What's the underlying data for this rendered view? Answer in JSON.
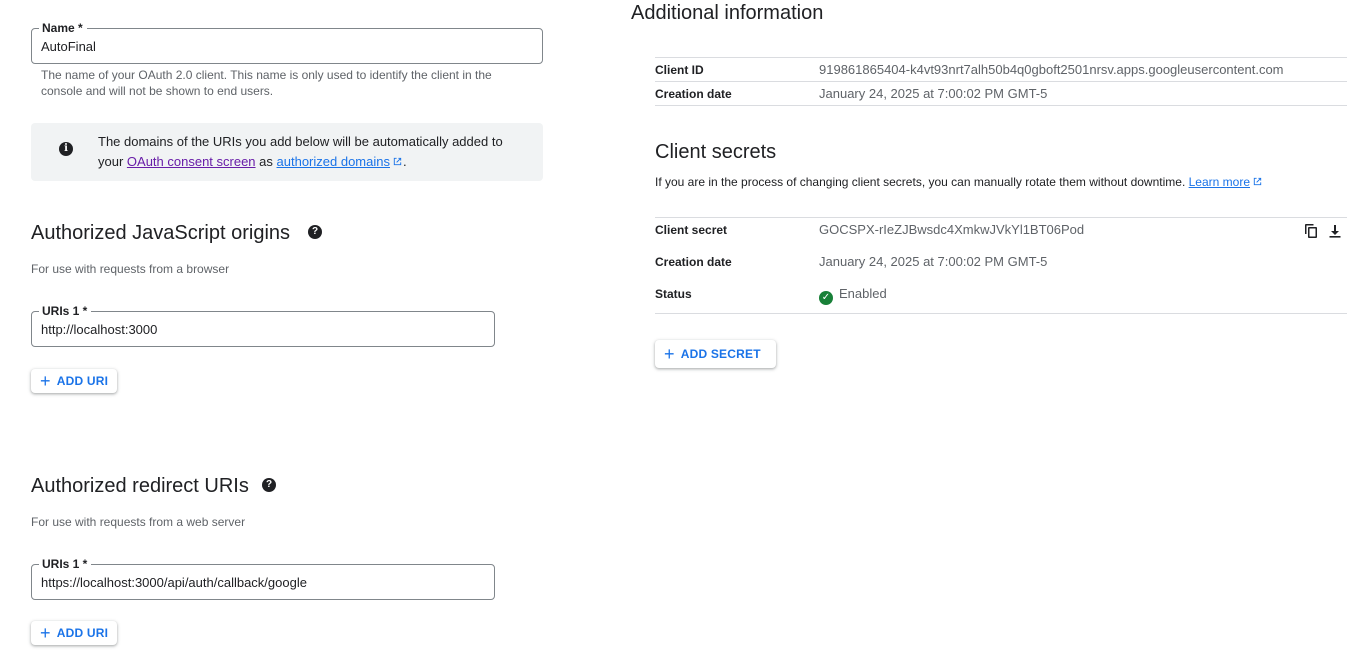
{
  "name_field": {
    "label": "Name *",
    "value": "AutoFinal",
    "help": "The name of your OAuth 2.0 client. This name is only used to identify the client in the console and will not be shown to end users."
  },
  "info_banner": {
    "icon": "info-icon",
    "text_before": "The domains of the URIs you add below will be automatically added to your ",
    "link1": "OAuth consent screen",
    "text_middle": " as ",
    "link2": "authorized domains",
    "text_after": "."
  },
  "js_origins": {
    "title": "Authorized JavaScript origins",
    "description": "For use with requests from a browser",
    "uri_label": "URIs 1 *",
    "uri_value": "http://localhost:3000",
    "add_label": "ADD URI"
  },
  "redirect_uris": {
    "title": "Authorized redirect URIs",
    "description": "For use with requests from a web server",
    "uri_label": "URIs 1 *",
    "uri_value": "https://localhost:3000/api/auth/callback/google",
    "add_label": "ADD URI"
  },
  "additional_info": {
    "title": "Additional information",
    "client_id_label": "Client ID",
    "client_id_value": "919861865404-k4vt93nrt7alh50b4q0gboft2501nrsv.apps.googleusercontent.com",
    "creation_date_label": "Creation date",
    "creation_date_value": "January 24, 2025 at 7:00:02 PM GMT-5"
  },
  "client_secrets": {
    "title": "Client secrets",
    "description": "If you are in the process of changing client secrets, you can manually rotate them without downtime.",
    "learn_more": "Learn more",
    "secret_label": "Client secret",
    "secret_value": "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",
    "creation_date_label": "Creation date",
    "creation_date_value": "January 24, 2025 at 7:00:02 PM GMT-5",
    "status_label": "Status",
    "status_value": "Enabled",
    "add_secret_label": "ADD SECRET"
  },
  "colors": {
    "accent": "#1a73e8",
    "enabled": "#188038",
    "visited_link": "#681da8"
  }
}
